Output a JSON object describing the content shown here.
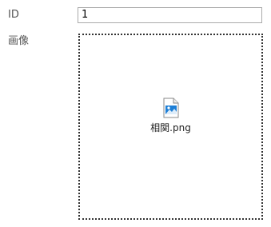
{
  "form": {
    "id_label": "ID",
    "id_value": "1",
    "image_label": "画像",
    "dropzone": {
      "file": {
        "name": "相関.png",
        "icon": "image-file-icon",
        "accent_color": "#1e7fd6"
      }
    }
  }
}
